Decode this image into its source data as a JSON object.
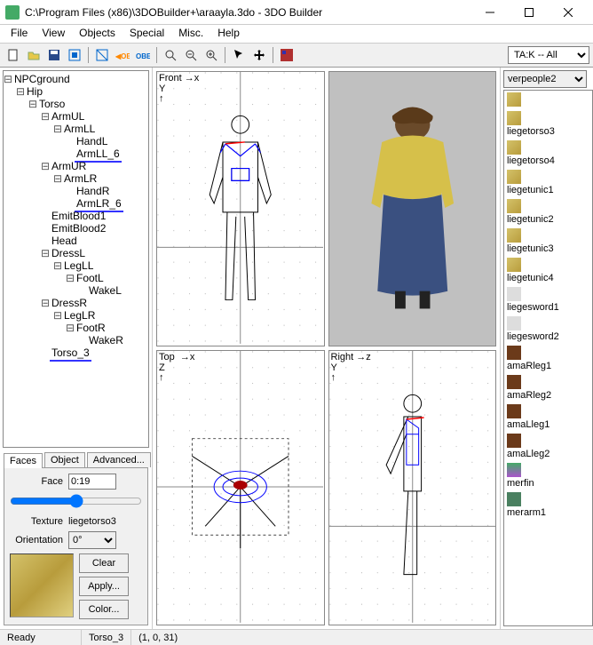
{
  "title": "C:\\Program Files (x86)\\3DOBuilder+\\araayla.3do - 3DO Builder",
  "menus": [
    "File",
    "View",
    "Objects",
    "Special",
    "Misc.",
    "Help"
  ],
  "dropdowns": {
    "game": "TA:K -- All",
    "texset": "verpeople2"
  },
  "tree": [
    {
      "name": "NPCground",
      "children": [
        {
          "name": "Hip",
          "children": [
            {
              "name": "Torso",
              "children": [
                {
                  "name": "ArmUL",
                  "children": [
                    {
                      "name": "ArmLL",
                      "children": [
                        {
                          "name": "HandL"
                        },
                        {
                          "name": "ArmLL_6",
                          "underline": true
                        }
                      ]
                    }
                  ]
                },
                {
                  "name": "ArmUR",
                  "children": [
                    {
                      "name": "ArmLR",
                      "children": [
                        {
                          "name": "HandR"
                        },
                        {
                          "name": "ArmLR_6",
                          "underline": true
                        }
                      ]
                    }
                  ]
                },
                {
                  "name": "EmitBlood1"
                },
                {
                  "name": "EmitBlood2"
                },
                {
                  "name": "Head"
                },
                {
                  "name": "DressL",
                  "children": [
                    {
                      "name": "LegLL",
                      "children": [
                        {
                          "name": "FootL",
                          "children": [
                            {
                              "name": "WakeL"
                            }
                          ]
                        }
                      ]
                    }
                  ]
                },
                {
                  "name": "DressR",
                  "children": [
                    {
                      "name": "LegLR",
                      "children": [
                        {
                          "name": "FootR",
                          "children": [
                            {
                              "name": "WakeR"
                            }
                          ]
                        }
                      ]
                    }
                  ]
                },
                {
                  "name": "Torso_3",
                  "underline": true
                }
              ]
            }
          ]
        }
      ]
    }
  ],
  "tabs": [
    "Faces",
    "Object",
    "Advanced..."
  ],
  "face_panel": {
    "face_label": "Face",
    "face_value": "0:19",
    "texture_label": "Texture",
    "texture_value": "liegetorso3",
    "orientation_label": "Orientation",
    "orientation_value": "0°",
    "buttons": {
      "clear": "Clear",
      "apply": "Apply...",
      "color": "Color..."
    }
  },
  "viewports": {
    "front": "Front →x\nY\n↑",
    "top": "Top  →x\nZ\n↑",
    "right": "Right →z\nY\n↑"
  },
  "textures": [
    {
      "name": "",
      "color": "linear-gradient(135deg,#d4c26a,#b89c3c)"
    },
    {
      "name": "liegetorso3",
      "color": "linear-gradient(135deg,#d4c26a,#b89c3c)"
    },
    {
      "name": "liegetorso4",
      "color": "linear-gradient(135deg,#d4c26a,#b89c3c)"
    },
    {
      "name": "liegetunic1",
      "color": "linear-gradient(135deg,#d4c26a,#b89c3c)"
    },
    {
      "name": "liegetunic2",
      "color": "linear-gradient(135deg,#d4c26a,#b89c3c)"
    },
    {
      "name": "liegetunic3",
      "color": "linear-gradient(135deg,#d4c26a,#b89c3c)"
    },
    {
      "name": "liegetunic4",
      "color": "linear-gradient(135deg,#d4c26a,#b89c3c)"
    },
    {
      "name": "liegesword1",
      "color": "#ddd"
    },
    {
      "name": "liegesword2",
      "color": "#ddd"
    },
    {
      "name": "amaRleg1",
      "color": "#6b3a1a"
    },
    {
      "name": "amaRleg2",
      "color": "#6b3a1a"
    },
    {
      "name": "amaLleg1",
      "color": "#6b3a1a"
    },
    {
      "name": "amaLleg2",
      "color": "#6b3a1a"
    },
    {
      "name": "merfin",
      "color": "linear-gradient(#4a6,#a5c)"
    },
    {
      "name": "merarm1",
      "color": "#4a8060"
    }
  ],
  "status": {
    "ready": "Ready",
    "selection": "Torso_3",
    "coords": "(1, 0, 31)"
  }
}
